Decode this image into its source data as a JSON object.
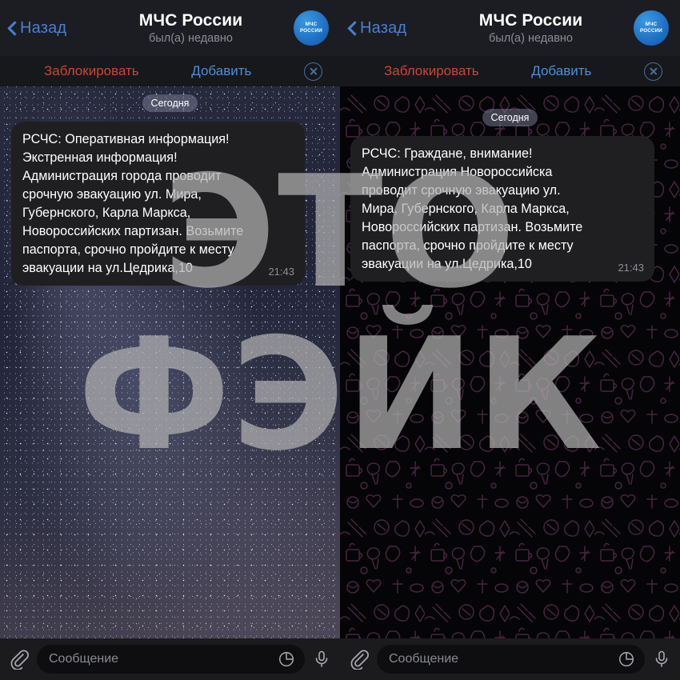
{
  "watermark": {
    "line1": "ЭТО",
    "line2": "ФЭЙК",
    "color": "#b2b2b2"
  },
  "colors": {
    "nav_bg": "#1c1d22",
    "action_bg": "#17181c",
    "block_red": "#cf4436",
    "add_blue": "#4a8fe0",
    "back_blue": "#4a7fd4",
    "bubble_bg": "#1f1f22",
    "input_bg": "#1b1b1e",
    "avatar_blue": "#1f6fc4"
  },
  "panels": [
    {
      "id": "left",
      "wallpaper": "starfield-photo",
      "header": {
        "back_label": "Назад",
        "title": "МЧС России",
        "subtitle": "был(а) недавно",
        "avatar_line1": "МЧС",
        "avatar_line2": "РОССИИ"
      },
      "actions": {
        "block_label": "Заблокировать",
        "add_label": "Добавить",
        "close_icon": "close-circle-icon"
      },
      "date_divider": "Сегодня",
      "message": {
        "text": "РСЧС: Оперативная информация!\nЭкстренная информация!\nАдминистрация города проводит\nсрочную эвакуацию ул. Мира,\nГубернского, Карла Маркса,\nНовороссийских партизан. Возьмите\nпаспорта, срочно пройдите к месту\nэвакуации на ул.Цедрика,10",
        "time": "21:43"
      },
      "input": {
        "placeholder": "Сообщение",
        "attach_icon": "paperclip-icon",
        "sticker_icon": "sticker-icon",
        "voice_icon": "microphone-icon"
      }
    },
    {
      "id": "right",
      "wallpaper": "doodle-pattern",
      "header": {
        "back_label": "Назад",
        "title": "МЧС России",
        "subtitle": "был(а) недавно",
        "avatar_line1": "МЧС",
        "avatar_line2": "РОССИИ"
      },
      "actions": {
        "block_label": "Заблокировать",
        "add_label": "Добавить",
        "close_icon": "close-circle-icon"
      },
      "date_divider": "Сегодня",
      "message": {
        "text": "РСЧС: Граждане, внимание!\nАдминистрация Новороссийска\nпроводит срочную эвакуацию ул.\nМира, Губернского, Карла Маркса,\nНовороссийских партизан. Возьмите\nпаспорта, срочно пройдите к месту\nэвакуации на ул.Цедрика,10",
        "time": "21:43"
      },
      "input": {
        "placeholder": "Сообщение",
        "attach_icon": "paperclip-icon",
        "sticker_icon": "sticker-icon",
        "voice_icon": "microphone-icon"
      }
    }
  ]
}
